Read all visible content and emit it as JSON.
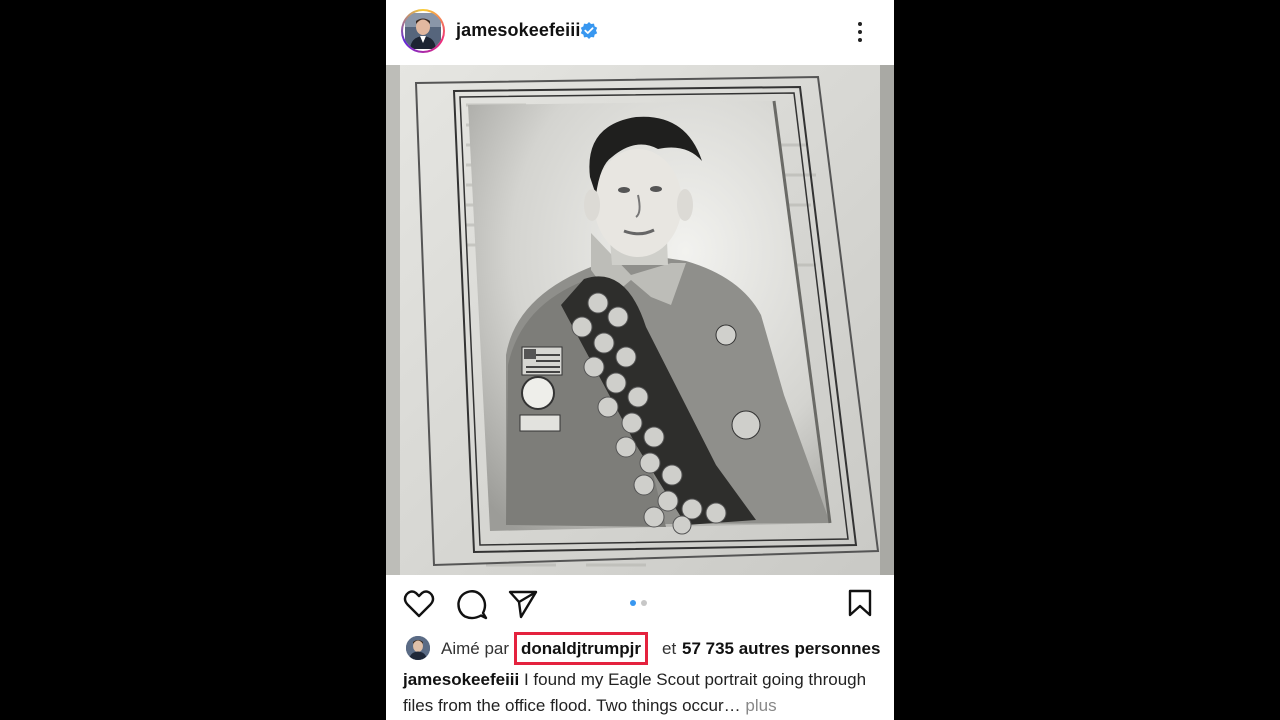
{
  "post": {
    "username": "jamesokeefeiii",
    "verified": true,
    "menu_icon": "more-vertical-icon"
  },
  "photo": {
    "type": "black-and-white portrait photo in a printed frame"
  },
  "actions": {
    "like_icon": "heart-icon",
    "comment_icon": "comment-icon",
    "share_icon": "send-icon",
    "save_icon": "bookmark-icon",
    "carousel": {
      "total": 2,
      "active": 1,
      "active_color": "#3897f0",
      "inactive_color": "#c7c7c7"
    }
  },
  "likes": {
    "prefix": "Aimé par",
    "liker": "donaldjtrumpjr",
    "conjunction": "et",
    "others": "57 735 autres personnes",
    "highlight_color": "#e4223e"
  },
  "caption": {
    "username": "jamesokeefeiii",
    "text": "I found my Eagle Scout portrait going through files from the office flood. Two things occur…",
    "more_label": "plus"
  },
  "colors": {
    "verified_blue": "#3897f0",
    "background": "#000000"
  }
}
